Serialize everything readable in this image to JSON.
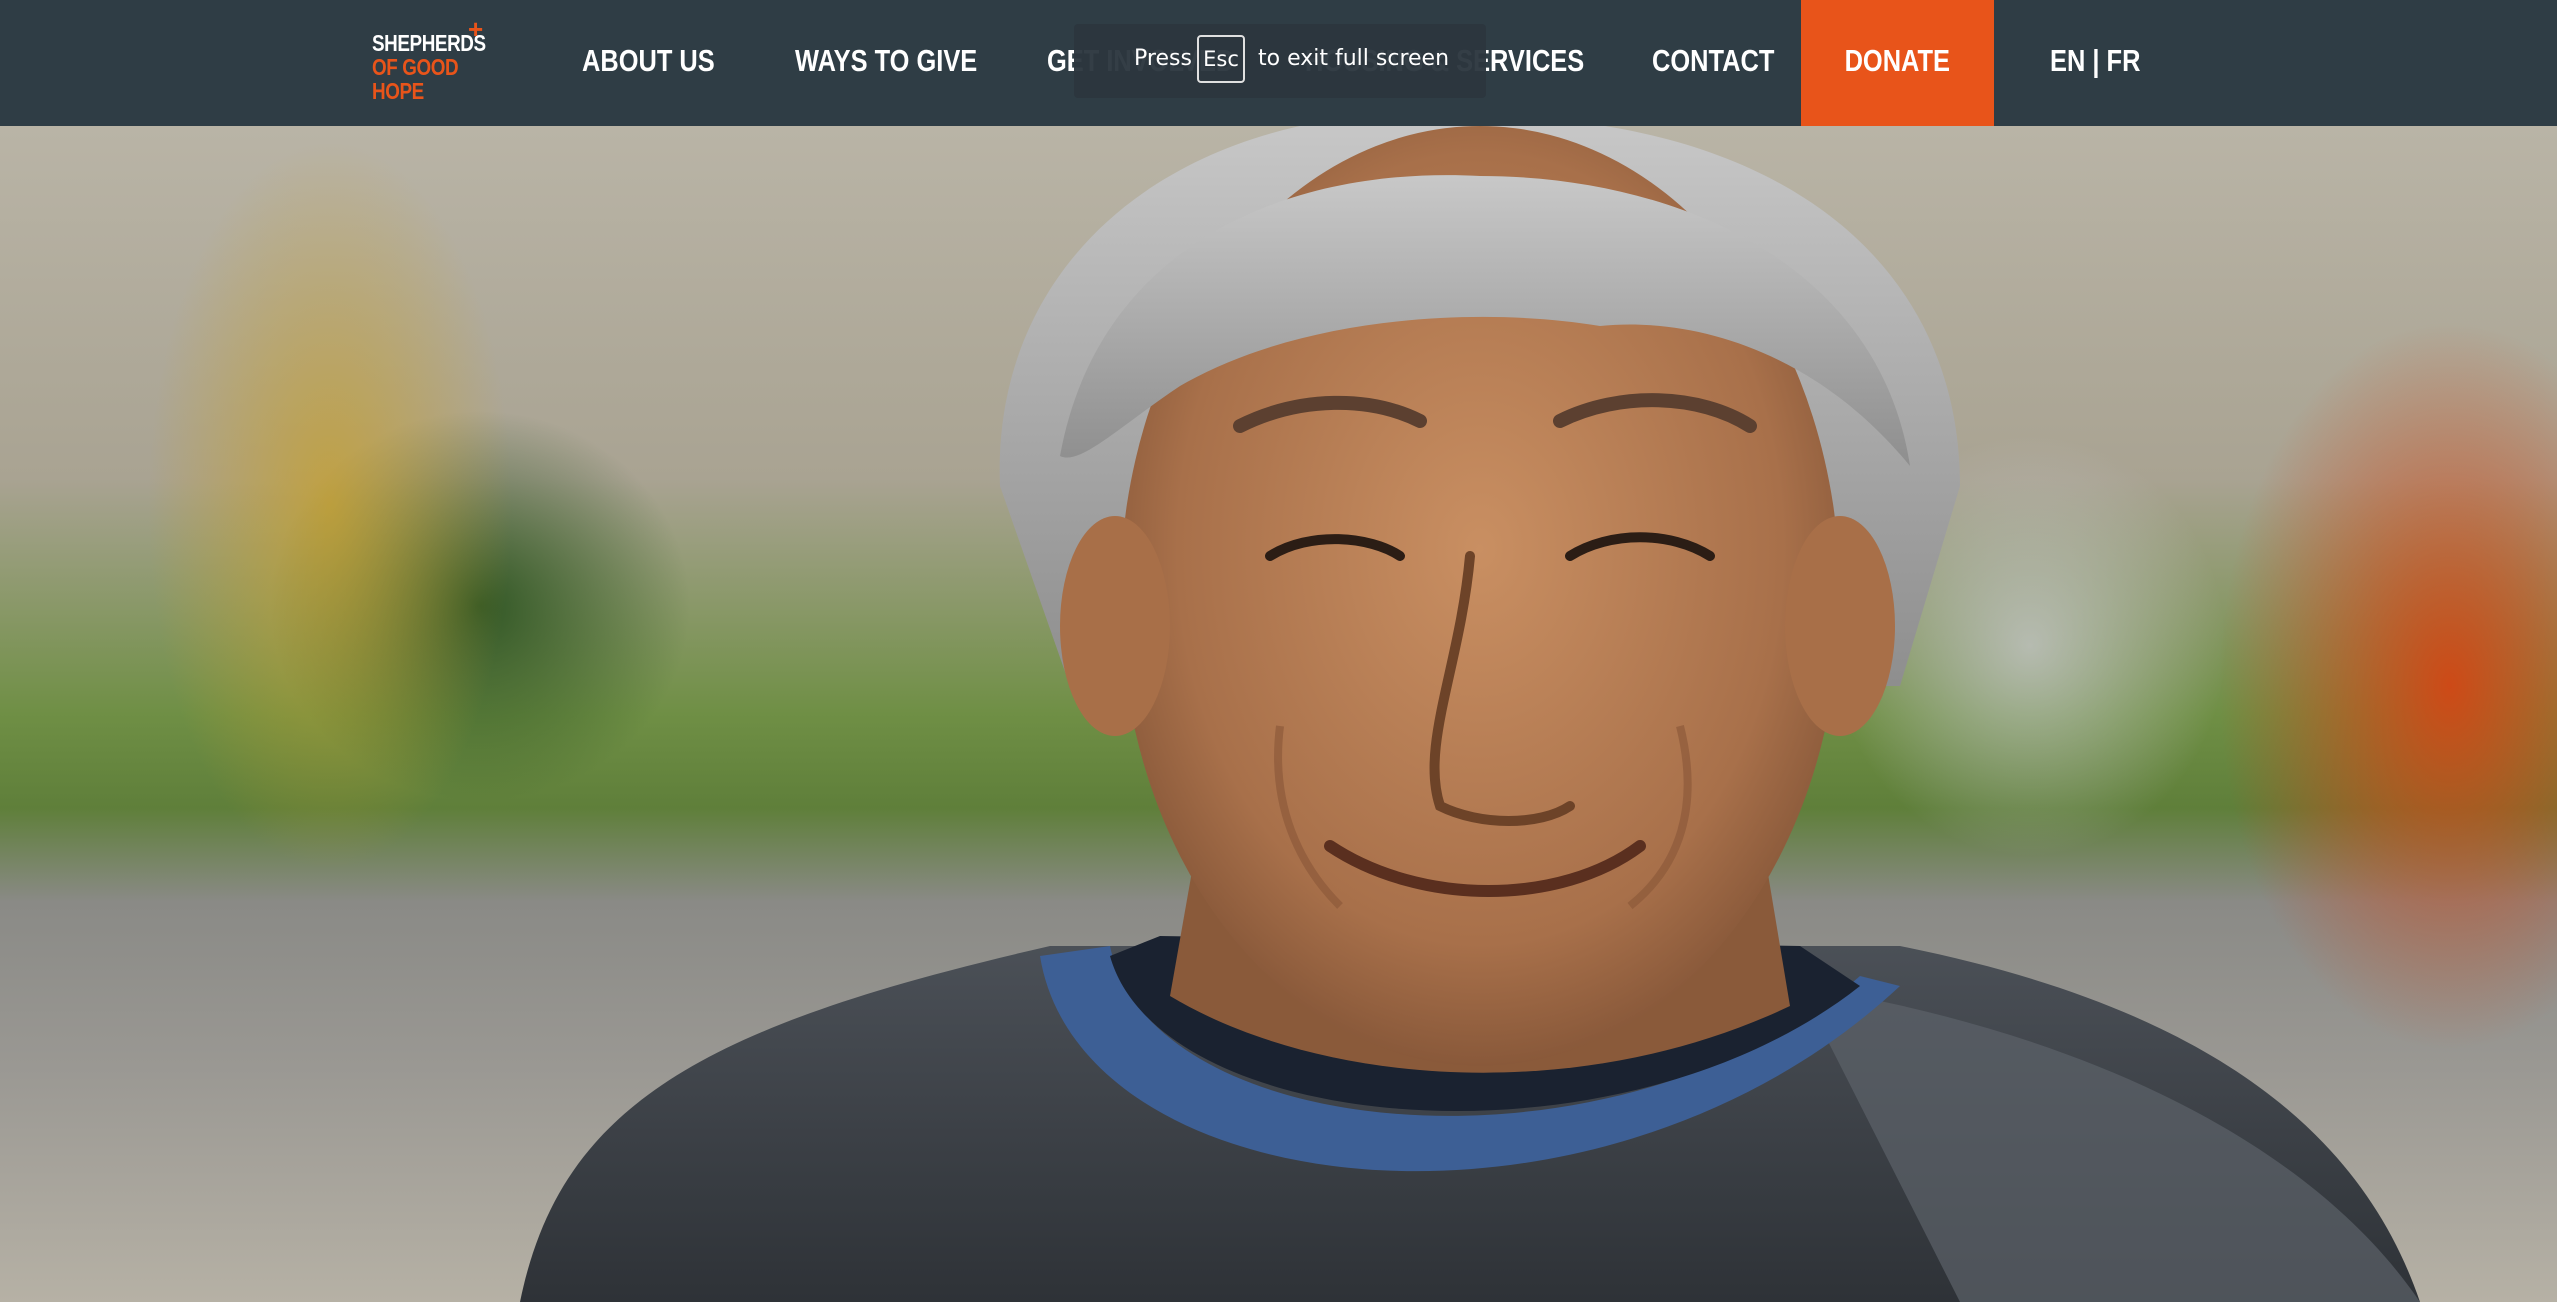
{
  "logo": {
    "line1": "SHEPHERDS",
    "line2": "OF GOOD",
    "line3": "HOPE",
    "star": "+"
  },
  "nav": {
    "items": [
      {
        "label": "ABOUT US"
      },
      {
        "label": "WAYS TO GIVE"
      },
      {
        "label": "GET INVOLVED"
      },
      {
        "label": "HOUSING & SERVICES"
      },
      {
        "label": "CONTACT"
      }
    ],
    "donate": "DONATE",
    "language": "EN | FR"
  },
  "fullscreen_toast": {
    "before": "Press",
    "key": "Esc",
    "after": "to exit full screen"
  },
  "colors": {
    "nav_bg": "#2f3d45",
    "accent": "#e8541a",
    "text": "#ffffff"
  },
  "hero": {
    "alt": "Smiling older man with grey hair wearing a dark sweater with blue collar"
  }
}
